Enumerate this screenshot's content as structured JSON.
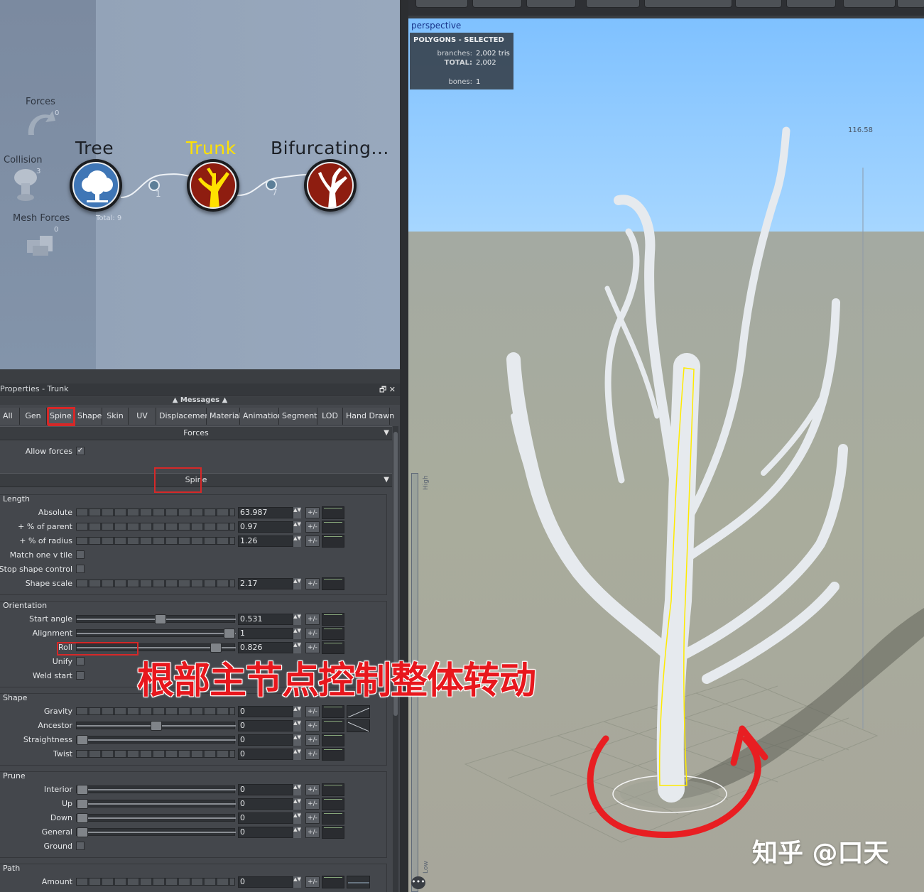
{
  "graph": {
    "generators": [
      {
        "label": "Forces",
        "count": "0"
      },
      {
        "label": "Collision",
        "count": "3"
      },
      {
        "label": "Mesh Forces",
        "count": "0"
      }
    ],
    "nodes": [
      {
        "title": "Tree",
        "icon": "tree-icon"
      },
      {
        "title": "Trunk",
        "icon": "trunk-icon"
      },
      {
        "title": "Bifurcating...",
        "icon": "bifurcating-icon"
      }
    ],
    "links": [
      "1",
      "7"
    ],
    "total": "Total: 9"
  },
  "properties": {
    "title": "Properties - Trunk",
    "controls": "🗗 ✕",
    "messages": "▲  Messages  ▲",
    "tabs": [
      "All",
      "Gen",
      "Spine",
      "Shape",
      "Skin",
      "UV",
      "Displacement",
      "Material",
      "Animation",
      "Segments",
      "LOD",
      "Hand Drawn"
    ],
    "active_tab": "Spine",
    "sections": {
      "forces": {
        "header": "Forces",
        "allow_forces_label": "Allow forces",
        "allow_forces_checked": true
      },
      "spine": {
        "header": "Spine"
      }
    },
    "length": {
      "label": "Length",
      "absolute": {
        "label": "Absolute",
        "value": "63.987"
      },
      "pct_parent": {
        "label": "+ % of parent",
        "value": "0.97"
      },
      "pct_radius": {
        "label": "+ % of radius",
        "value": "1.26"
      },
      "match_v": {
        "label": "Match one v tile"
      },
      "stop_shape": {
        "label": "Stop shape control"
      },
      "shape_scale": {
        "label": "Shape scale",
        "value": "2.17"
      }
    },
    "orientation": {
      "label": "Orientation",
      "start_angle": {
        "label": "Start angle",
        "value": "0.531"
      },
      "alignment": {
        "label": "Alignment",
        "value": "1"
      },
      "roll": {
        "label": "Roll",
        "value": "0.826"
      },
      "unify": {
        "label": "Unify"
      },
      "weld_start": {
        "label": "Weld start"
      }
    },
    "shape": {
      "label": "Shape",
      "gravity": {
        "label": "Gravity",
        "value": "0"
      },
      "ancestor": {
        "label": "Ancestor",
        "value": "0"
      },
      "straightness": {
        "label": "Straightness",
        "value": "0"
      },
      "twist": {
        "label": "Twist",
        "value": "0"
      }
    },
    "prune": {
      "label": "Prune",
      "interior": {
        "label": "Interior",
        "value": "0"
      },
      "up": {
        "label": "Up",
        "value": "0"
      },
      "down": {
        "label": "Down",
        "value": "0"
      },
      "general": {
        "label": "General",
        "value": "0"
      },
      "ground": {
        "label": "Ground"
      }
    },
    "path": {
      "label": "Path",
      "amount": {
        "label": "Amount",
        "value": "0"
      }
    },
    "pm_label": "+/-",
    "spin_label": "▲▼"
  },
  "annotation": "根部主节点控制整体转动",
  "viewport": {
    "label": "perspective",
    "stats": {
      "header": "POLYGONS - SELECTED",
      "branches_key": "branches:",
      "branches_val": "2,002 tris",
      "total_key": "TOTAL:",
      "total_val": "2,002",
      "bones_key": "bones:",
      "bones_val": "1"
    },
    "measure": "116.58",
    "high": "High",
    "low": "Low",
    "menu": "•••"
  },
  "watermark": "知乎 @口天",
  "colors": {
    "selected_node": "#ffe100",
    "annotation": "#e8171d",
    "sky": "#7fc1ff"
  }
}
